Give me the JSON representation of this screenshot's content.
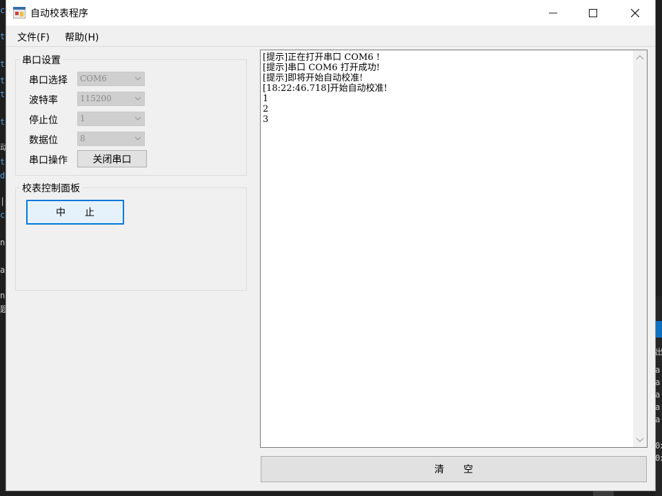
{
  "window": {
    "title": "自动校表程序",
    "controls": {
      "minimize": "minimize",
      "maximize": "maximize",
      "close": "close"
    }
  },
  "menu": {
    "file": "文件(F)",
    "help": "帮助(H)"
  },
  "serial_settings": {
    "title": "串口设置",
    "port_label": "串口选择",
    "port_value": "COM6",
    "baud_label": "波特率",
    "baud_value": "115200",
    "stopbits_label": "停止位",
    "stopbits_value": "1",
    "databits_label": "数据位",
    "databits_value": "8",
    "operation_label": "串口操作",
    "close_port_button": "关闭串口"
  },
  "control_panel": {
    "title": "校表控制面板",
    "stop_button": "中　　止"
  },
  "log": {
    "lines": [
      "[提示]正在打开串口 COM6 !",
      "[提示]串口 COM6 打开成功!",
      "[提示]即将开始自动校准!",
      "[18:22:46.718]开始自动校准!",
      "1",
      "2",
      "3"
    ]
  },
  "clear_button": "清　　空",
  "background_fragments": [
    "c",
    "t",
    "t",
    "t",
    "t",
    "t",
    "动",
    "t",
    "d",
    "|",
    "c",
    "n",
    "a",
    "n",
    "题",
    "出",
    "a",
    "a",
    "a",
    "a",
    "a",
    "0x",
    "0x"
  ],
  "colors": {
    "accent": "#0078d7",
    "window_bg": "#f0f0f0",
    "disabled_combo": "#cfcfcf"
  }
}
